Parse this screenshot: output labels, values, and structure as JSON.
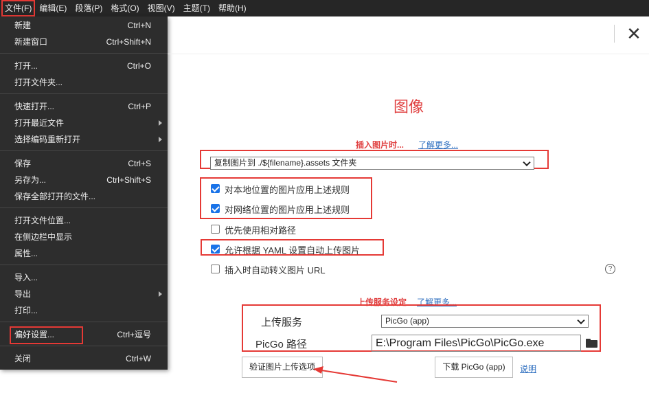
{
  "menubar": {
    "items": [
      "文件(F)",
      "编辑(E)",
      "段落(P)",
      "格式(O)",
      "视图(V)",
      "主题(T)",
      "帮助(H)"
    ]
  },
  "file_menu": {
    "items": [
      {
        "label": "新建",
        "shortcut": "Ctrl+N"
      },
      {
        "label": "新建窗口",
        "shortcut": "Ctrl+Shift+N"
      },
      {
        "label": "打开...",
        "shortcut": "Ctrl+O"
      },
      {
        "label": "打开文件夹...",
        "shortcut": ""
      },
      {
        "label": "快速打开...",
        "shortcut": "Ctrl+P"
      },
      {
        "label": "打开最近文件",
        "shortcut": ""
      },
      {
        "label": "选择编码重新打开",
        "shortcut": ""
      },
      {
        "label": "保存",
        "shortcut": "Ctrl+S"
      },
      {
        "label": "另存为...",
        "shortcut": "Ctrl+Shift+S"
      },
      {
        "label": "保存全部打开的文件...",
        "shortcut": ""
      },
      {
        "label": "打开文件位置...",
        "shortcut": ""
      },
      {
        "label": "在侧边栏中显示",
        "shortcut": ""
      },
      {
        "label": "属性...",
        "shortcut": ""
      },
      {
        "label": "导入...",
        "shortcut": ""
      },
      {
        "label": "导出",
        "shortcut": ""
      },
      {
        "label": "打印...",
        "shortcut": ""
      },
      {
        "label": "偏好设置...",
        "shortcut": "Ctrl+逗号"
      },
      {
        "label": "关闭",
        "shortcut": "Ctrl+W"
      }
    ]
  },
  "prefs": {
    "close_glyph": "✕",
    "title": "图像",
    "insert_heading": "插入图片时...",
    "learn_more": "了解更多...",
    "insert_select": "复制图片到 ./${filename}.assets 文件夹",
    "checkboxes": [
      {
        "label": "对本地位置的图片应用上述规则",
        "checked": true
      },
      {
        "label": "对网络位置的图片应用上述规则",
        "checked": true
      },
      {
        "label": "优先使用相对路径",
        "checked": false
      },
      {
        "label": "允许根据 YAML 设置自动上传图片",
        "checked": true
      },
      {
        "label": "插入时自动转义图片 URL",
        "checked": false
      }
    ],
    "help_glyph": "?",
    "upload_heading": "上传服务设定",
    "learn_more_2": "了解更多...",
    "upload_service_label": "上传服务",
    "upload_service_value": "PicGo (app)",
    "picgo_path_label": "PicGo 路径",
    "picgo_path_value": "E:\\Program Files\\PicGo\\PicGo.exe",
    "verify_button": "验证图片上传选项",
    "download_button": "下载 PicGo (app)",
    "explain_link": "说明"
  },
  "colors": {
    "annotation_red": "#e53935",
    "accent_blue": "#1a73e8",
    "heading_red": "#e04040"
  }
}
